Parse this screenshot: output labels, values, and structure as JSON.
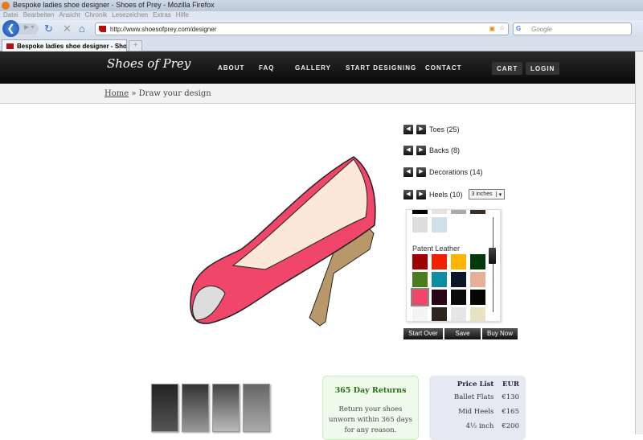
{
  "browser": {
    "window_title": "Bespoke ladies shoe designer - Shoes of Prey - Mozilla Firefox",
    "menu": [
      "Datei",
      "Bearbeiten",
      "Ansicht",
      "Chronik",
      "Lesezeichen",
      "Extras",
      "Hilfe"
    ],
    "url": "http://www.shoesofprey.com/designer",
    "search_placeholder": "Google",
    "tab_title": "Bespoke ladies shoe designer - Shoes...",
    "new_tab": "+"
  },
  "site": {
    "logo": "Shoes of Prey",
    "nav": [
      "About",
      "FAQ",
      "Gallery",
      "Start Designing",
      "Contact"
    ],
    "cart": "Cart",
    "login": "Login"
  },
  "breadcrumb": {
    "home": "Home",
    "sep": " » ",
    "current": "Draw your design"
  },
  "designer": {
    "options": [
      {
        "label": "Toes (25)"
      },
      {
        "label": "Backs (8)"
      },
      {
        "label": "Decorations (14)"
      },
      {
        "label": "Heels (10)"
      }
    ],
    "heel_height": "3 inches",
    "palette_heading": "Patent Leather",
    "swatches": [
      "#a00000",
      "#f02000",
      "#ffb400",
      "#003a0a",
      "#4a7d1e",
      "#0e8da0",
      "#0c1626",
      "#e5b09a",
      "#f0466a",
      "#260616",
      "#0b0b0b",
      "#050505",
      "#f4f4f4",
      "#2d261c",
      "#e6e6e6",
      "#e8e2c2"
    ],
    "selected_swatch": "#f0466a",
    "shoe_color": "#f0466a",
    "scroll_fraction": 0.3,
    "buttons": {
      "start_over": "Start Over",
      "save": "Save",
      "buy_now": "Buy Now"
    }
  },
  "returns": {
    "title": "365 Day Returns",
    "text": "Return your shoes unworn within 365 days for any reason."
  },
  "price_list": {
    "heading": "Price List",
    "currency": "EUR",
    "rows": [
      {
        "item": "Ballet Flats",
        "price": "€130"
      },
      {
        "item": "Mid Heels",
        "price": "€165"
      },
      {
        "item": "4½ inch",
        "price": "€200"
      }
    ]
  }
}
